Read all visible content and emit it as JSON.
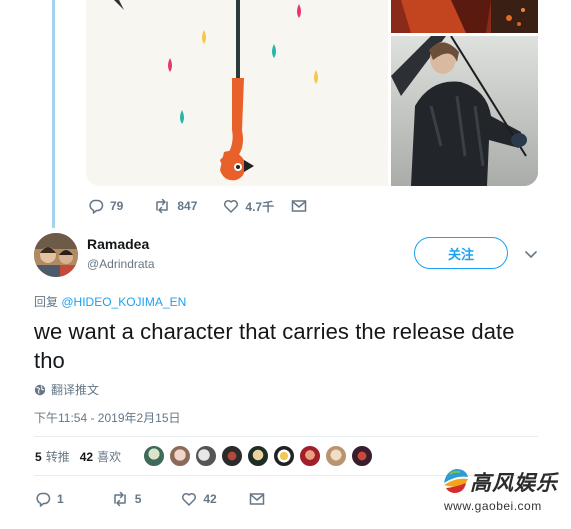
{
  "prev_tweet": {
    "actions": {
      "replies": "79",
      "retweets": "847",
      "likes": "4.7千"
    }
  },
  "reply": {
    "user": {
      "name": "Ramadea",
      "handle": "@Adrindrata"
    },
    "follow_label": "关注",
    "reply_prefix": "回复",
    "reply_to": "@HIDEO_KOJIMA_EN",
    "text": "we want a character that carries the release date tho",
    "translate_label": "翻译推文",
    "timestamp": "下午11:54 - 2019年2月15日",
    "stats": {
      "retweets_count": "5",
      "retweets_label": "转推",
      "likes_count": "42",
      "likes_label": "喜欢"
    },
    "actions": {
      "replies": "1",
      "retweets": "5",
      "likes": "42"
    }
  },
  "watermark": {
    "brand": "高风娱乐",
    "url": "www.gaobei.com"
  },
  "colors": {
    "accent": "#1da1f2",
    "muted": "#657786",
    "thread_line": "#a5d3ef"
  }
}
